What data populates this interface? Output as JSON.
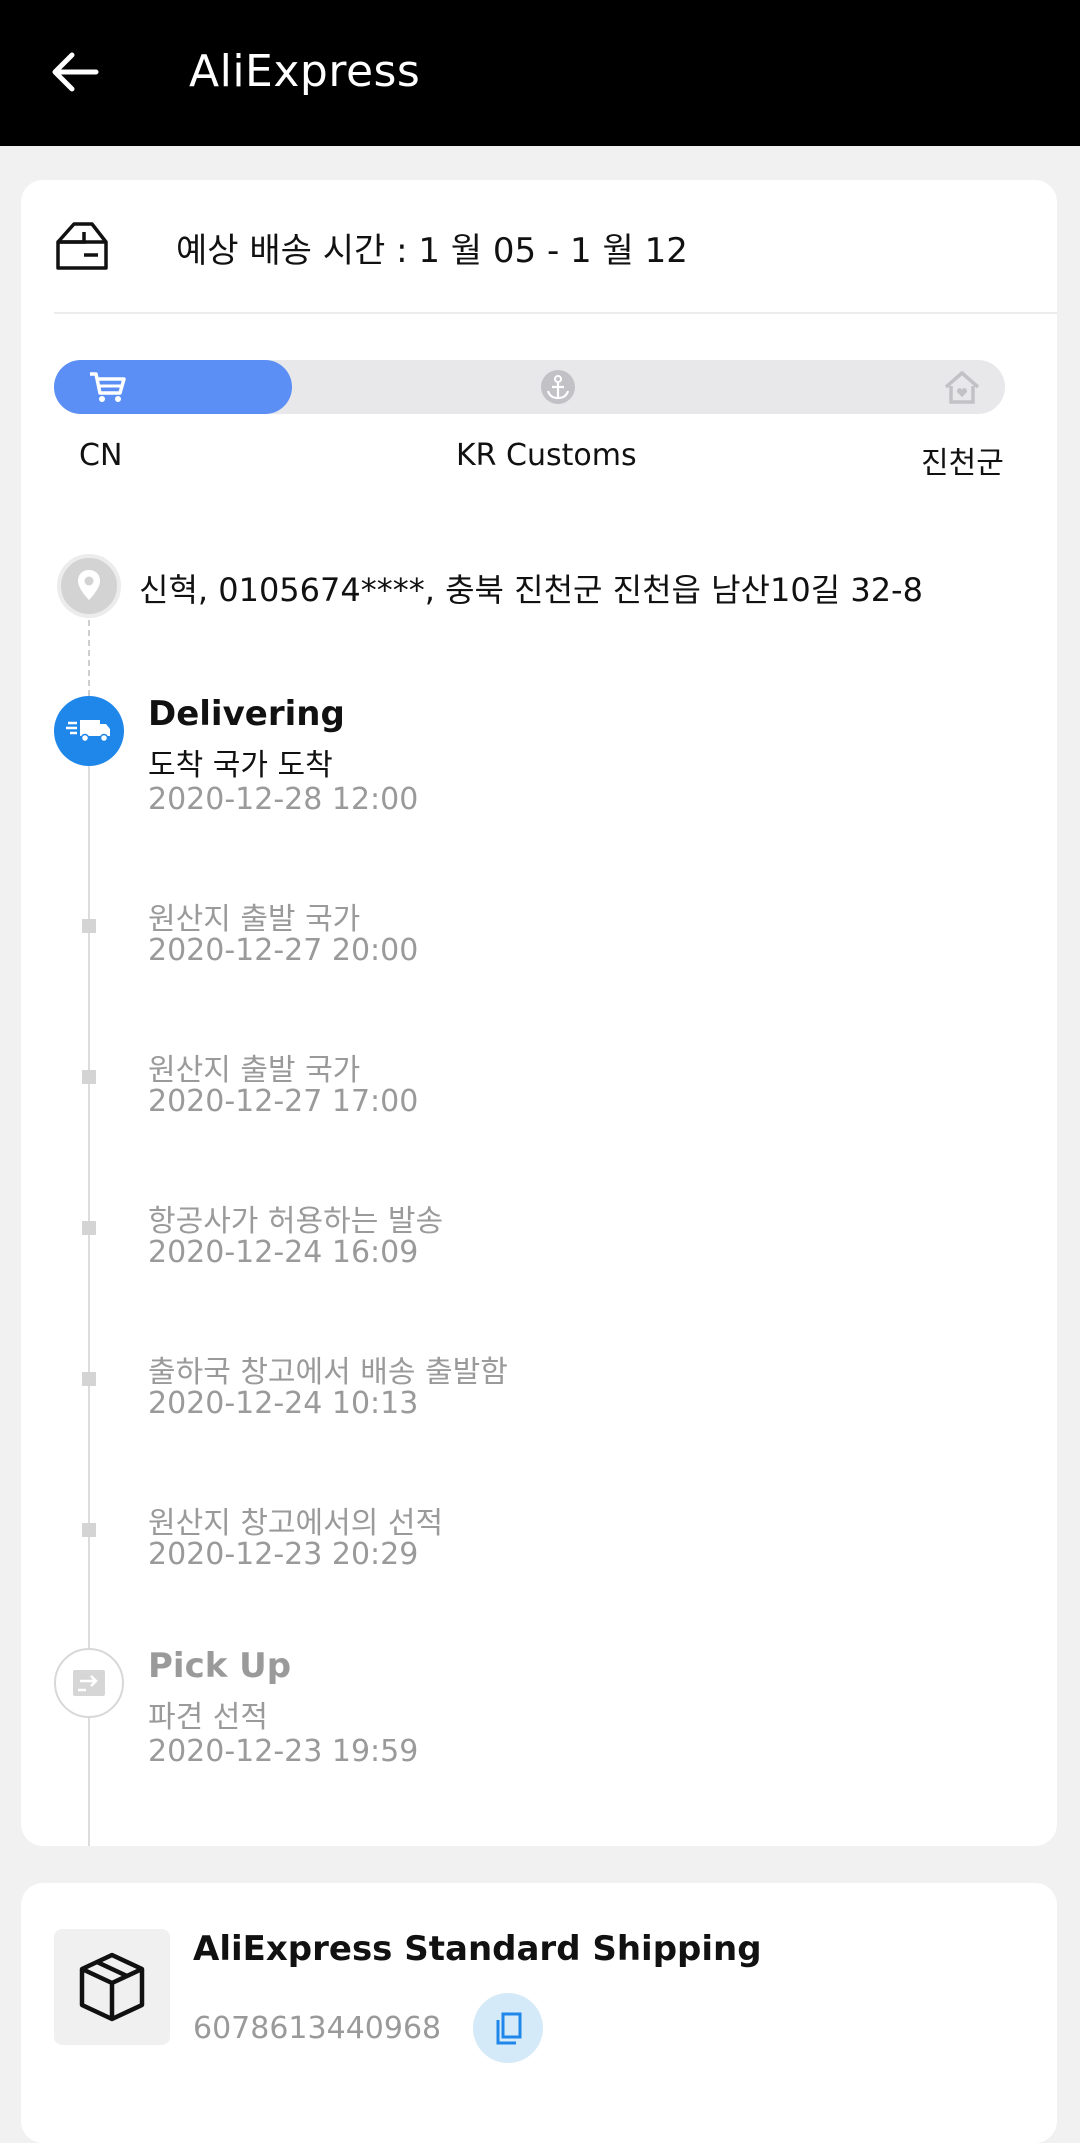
{
  "app": {
    "title": "AliExpress"
  },
  "eta": {
    "text": "예상 배송 시간 : 1 월 05 - 1 월 12"
  },
  "progress": {
    "fill_fraction": 0.25,
    "fill_color": "#5b8ff5",
    "stages": [
      {
        "label": "CN",
        "icon": "cart-icon"
      },
      {
        "label": "KR Customs",
        "icon": "anchor-icon"
      },
      {
        "label": "진천군",
        "icon": "home-icon"
      }
    ]
  },
  "address": {
    "text": "신혁, 0105674****, 충북 진천군 진천읍 남산10길 32-8"
  },
  "timeline": {
    "current": {
      "title": "Delivering",
      "subtitle": "도착 국가 도착",
      "date": "2020-12-28 12:00",
      "icon": "truck-icon",
      "color": "#1f86ea"
    },
    "events": [
      {
        "text": "원산지 출발 국가",
        "date": "2020-12-27 20:00"
      },
      {
        "text": "원산지 출발 국가",
        "date": "2020-12-27 17:00"
      },
      {
        "text": "항공사가 허용하는 발송",
        "date": "2020-12-24 16:09"
      },
      {
        "text": "출하국 창고에서 배송 출발함",
        "date": "2020-12-24 10:13"
      },
      {
        "text": "원산지 창고에서의 선적",
        "date": "2020-12-23 20:29"
      }
    ],
    "first": {
      "title": "Pick Up",
      "subtitle": "파견 선적",
      "date": "2020-12-23 19:59",
      "icon": "pickup-icon"
    }
  },
  "shipping": {
    "name": "AliExpress Standard Shipping",
    "tracking_number": "6078613440968"
  }
}
